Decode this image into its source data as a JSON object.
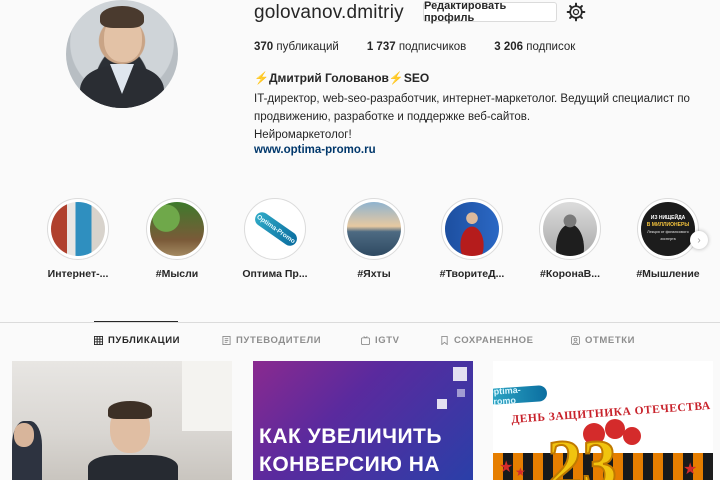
{
  "profile": {
    "username": "golovanov.dmitriy",
    "edit_button": "Редактировать профиль",
    "stats": [
      {
        "count": "370",
        "label": "публикаций"
      },
      {
        "count": "1 737",
        "label": "подписчиков"
      },
      {
        "count": "3 206",
        "label": "подписок"
      }
    ],
    "full_name": "⚡Дмитрий Голованов⚡SEO",
    "bio_lines": [
      "IT-директор, web-seo-разработчик, интернет-маркетолог. Ведущий специалист по",
      "продвижению, разработке и поддержке веб-сайтов.",
      "Нейромаркетолог!"
    ],
    "website": "www.optima-promo.ru"
  },
  "highlights": [
    {
      "label": "Интернет-..."
    },
    {
      "label": "#Мысли"
    },
    {
      "label": "Оптима Пр..."
    },
    {
      "label": "#Яхты"
    },
    {
      "label": "#ТворитеД..."
    },
    {
      "label": "#КоронаВ..."
    },
    {
      "label": "#Мышление"
    }
  ],
  "highlight_badges": {
    "optima": "Optima-Promo",
    "money_line1": "ИЗ НИЩЕЙДА",
    "money_line2": "В МИЛЛИОНЕРЫ",
    "money_line3": "Лекция от финансового эксперта"
  },
  "tabs": [
    {
      "label": "ПУБЛИКАЦИИ",
      "icon": "grid-icon",
      "active": true
    },
    {
      "label": "ПУТЕВОДИТЕЛИ",
      "icon": "guide-icon",
      "active": false
    },
    {
      "label": "IGTV",
      "icon": "igtv-icon",
      "active": false
    },
    {
      "label": "СОХРАНЕННОЕ",
      "icon": "bookmark-icon",
      "active": false
    },
    {
      "label": "ОТМЕТКИ",
      "icon": "tag-icon",
      "active": false
    }
  ],
  "posts": {
    "post2_line1": "КАК УВЕЛИЧИТЬ",
    "post2_line2": "КОНВЕРСИЮ НА",
    "post3_logo": "Optima-Promo",
    "post3_heading": "ДЕНЬ ЗАЩИТНИКА ОТЕЧЕСТВА",
    "post3_number": "23"
  },
  "colors": {
    "link": "#00376b",
    "border": "#dbdbdb",
    "text": "#262626",
    "muted": "#8e8e8e"
  }
}
